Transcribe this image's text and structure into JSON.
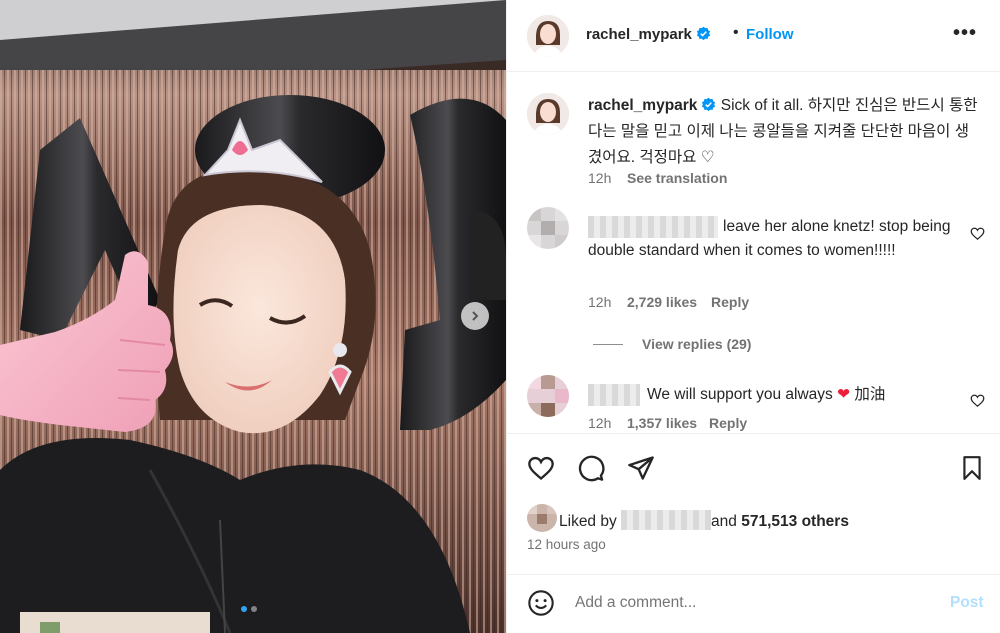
{
  "header": {
    "username": "rachel_mypark",
    "separator": "•",
    "follow_label": "Follow",
    "more_label": "•••"
  },
  "caption": {
    "username": "rachel_mypark",
    "text": "Sick of it all. 하지만 진심은 반드시 통한다는 말을 믿고 이제 나는 콩알들을 지켜줄 단단한 마음이 생겼어요. 걱정마요 ♡",
    "time": "12h",
    "translate_label": "See translation"
  },
  "comments": [
    {
      "text": "leave her alone knetz! stop being double standard when it comes to women!!!!!",
      "time": "12h",
      "likes": "2,729 likes",
      "reply_label": "Reply",
      "view_replies": "View replies (29)"
    },
    {
      "text": "We will support you always",
      "emoji": "❤",
      "text_after": "加油",
      "time": "12h",
      "likes": "1,357 likes",
      "reply_label": "Reply"
    }
  ],
  "likes": {
    "prefix": "Liked by",
    "connector": "and",
    "count": "571,513 others"
  },
  "posted_time": "12 hours ago",
  "add_comment": {
    "placeholder": "Add a comment...",
    "post_label": "Post"
  },
  "colors": {
    "accent": "#0095f6",
    "text": "#262626",
    "secondary": "#737373",
    "like_heart": "#ed1f3b"
  },
  "icons": [
    "verified-badge-icon",
    "more-icon",
    "heart-icon",
    "comment-icon",
    "share-icon",
    "bookmark-icon",
    "emoji-icon",
    "chevron-right-icon"
  ]
}
